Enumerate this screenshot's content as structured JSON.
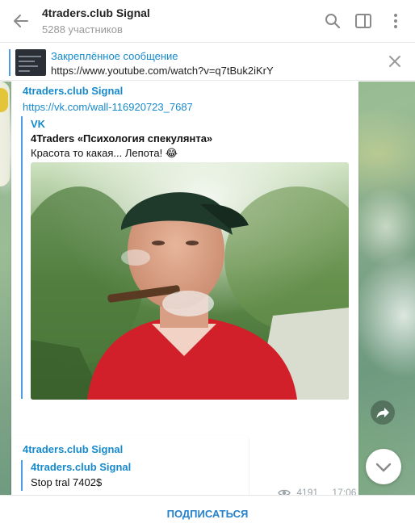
{
  "header": {
    "title": "4traders.club Signal",
    "subtitle": "5288 участников"
  },
  "pinned": {
    "title": "Закреплённое сообщение",
    "text": "https://www.youtube.com/watch?v=q7tBuk2iKrY"
  },
  "messages": [
    {
      "sender": "4traders.club Signal",
      "link": "https://vk.com/wall-116920723_7687",
      "preview": {
        "site": "VK",
        "title": "4Traders «Психология спекулянта»",
        "description": "Красота то какая... Лепота! 😂"
      },
      "views": "4191",
      "time": "17:06"
    },
    {
      "sender": "4traders.club Signal",
      "forwarded_from": "4traders.club Signal",
      "text": "Stop tral 7402$"
    }
  ],
  "footer": {
    "subscribe_label": "ПОДПИСАТЬСЯ"
  },
  "colors": {
    "accent": "#168acd",
    "quote_line": "#4c9ce2",
    "subscribe": "#2481cc"
  },
  "icons": {
    "back": "arrow-left-icon",
    "search": "search-icon",
    "sidebar": "sidebar-toggle-icon",
    "more": "more-vertical-icon",
    "close": "close-icon",
    "views": "eye-icon",
    "share": "share-icon",
    "scroll": "chevron-down-icon"
  }
}
